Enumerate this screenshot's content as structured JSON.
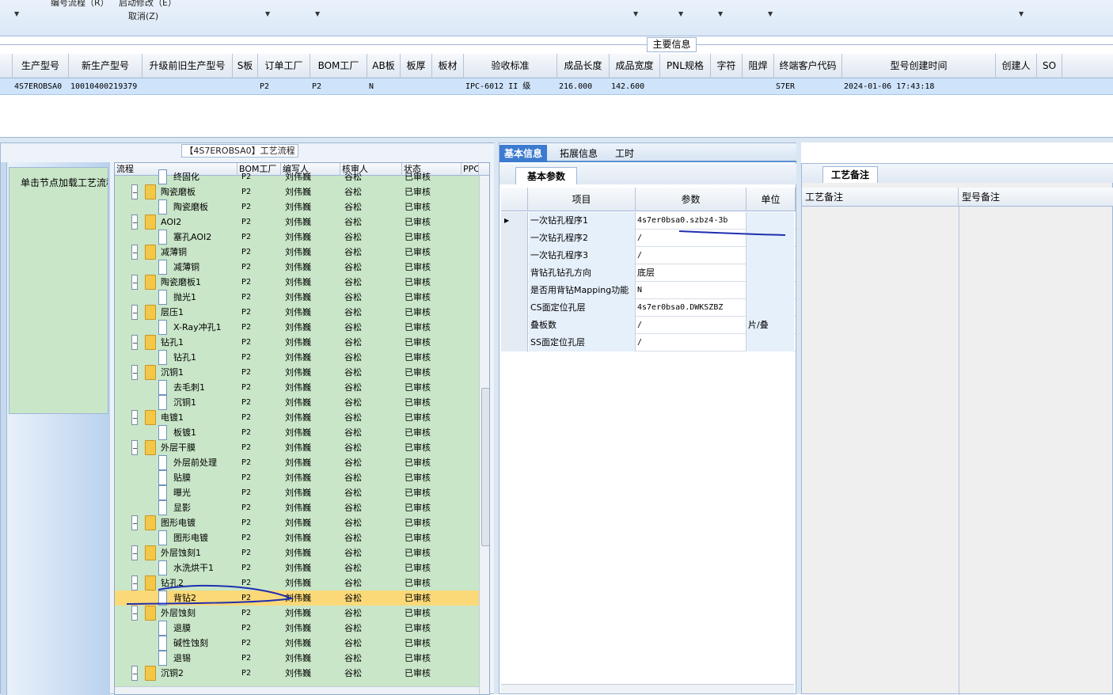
{
  "toolbar": {
    "menu1": "编号流程（R）",
    "menu2": "启动修改（E）",
    "menu3": "取消(Z)"
  },
  "main_info": {
    "title": "主要信息"
  },
  "grid": {
    "columns": [
      "生产型号",
      "新生产型号",
      "升级前旧生产型号",
      "S板",
      "订单工厂",
      "BOM工厂",
      "AB板",
      "板厚",
      "板材",
      "验收标准",
      "成品长度",
      "成品宽度",
      "PNL规格",
      "字符",
      "阻焊",
      "终端客户代码",
      "型号创建时间",
      "创建人",
      "SO"
    ],
    "row": {
      "model": "4S7EROBSA0",
      "new_model": "10010400219379",
      "order_factory": "P2",
      "bom_factory": "P2",
      "ab_board": "N",
      "standard": "IPC-6012 II 级",
      "length": "216.000",
      "width": "142.600",
      "customer_code": "S7ER",
      "created_time": "2024-01-06 17:43:18"
    }
  },
  "flow_panel": {
    "title": "【4S7EROBSA0】工艺流程",
    "load_label": "单击节点加载工艺流程",
    "columns": [
      "流程",
      "BOM工厂",
      "编写人",
      "核审人",
      "状态",
      "PPC"
    ],
    "rows": [
      {
        "level": 2,
        "type": "doc",
        "name": "终固化",
        "factory": "P2",
        "writer": "刘伟巍",
        "reviewer": "谷松",
        "status": "已审核"
      },
      {
        "level": 1,
        "type": "folder",
        "name": "陶瓷磨板",
        "factory": "P2",
        "writer": "刘伟巍",
        "reviewer": "谷松",
        "status": "已审核"
      },
      {
        "level": 2,
        "type": "doc",
        "name": "陶瓷磨板",
        "factory": "P2",
        "writer": "刘伟巍",
        "reviewer": "谷松",
        "status": "已审核"
      },
      {
        "level": 1,
        "type": "folder",
        "name": "AOI2",
        "factory": "P2",
        "writer": "刘伟巍",
        "reviewer": "谷松",
        "status": "已审核"
      },
      {
        "level": 2,
        "type": "doc",
        "name": "塞孔AOI2",
        "factory": "P2",
        "writer": "刘伟巍",
        "reviewer": "谷松",
        "status": "已审核"
      },
      {
        "level": 1,
        "type": "folder",
        "name": "减薄铜",
        "factory": "P2",
        "writer": "刘伟巍",
        "reviewer": "谷松",
        "status": "已审核"
      },
      {
        "level": 2,
        "type": "doc",
        "name": "减薄铜",
        "factory": "P2",
        "writer": "刘伟巍",
        "reviewer": "谷松",
        "status": "已审核"
      },
      {
        "level": 1,
        "type": "folder",
        "name": "陶瓷磨板1",
        "factory": "P2",
        "writer": "刘伟巍",
        "reviewer": "谷松",
        "status": "已审核"
      },
      {
        "level": 2,
        "type": "doc",
        "name": "抛光1",
        "factory": "P2",
        "writer": "刘伟巍",
        "reviewer": "谷松",
        "status": "已审核"
      },
      {
        "level": 1,
        "type": "folder",
        "name": "层压1",
        "factory": "P2",
        "writer": "刘伟巍",
        "reviewer": "谷松",
        "status": "已审核"
      },
      {
        "level": 2,
        "type": "doc",
        "name": "X-Ray冲孔1",
        "factory": "P2",
        "writer": "刘伟巍",
        "reviewer": "谷松",
        "status": "已审核"
      },
      {
        "level": 1,
        "type": "folder",
        "name": "钻孔1",
        "factory": "P2",
        "writer": "刘伟巍",
        "reviewer": "谷松",
        "status": "已审核"
      },
      {
        "level": 2,
        "type": "doc",
        "name": "钻孔1",
        "factory": "P2",
        "writer": "刘伟巍",
        "reviewer": "谷松",
        "status": "已审核"
      },
      {
        "level": 1,
        "type": "folder",
        "name": "沉铜1",
        "factory": "P2",
        "writer": "刘伟巍",
        "reviewer": "谷松",
        "status": "已审核"
      },
      {
        "level": 2,
        "type": "doc",
        "name": "去毛刺1",
        "factory": "P2",
        "writer": "刘伟巍",
        "reviewer": "谷松",
        "status": "已审核"
      },
      {
        "level": 2,
        "type": "doc",
        "name": "沉铜1",
        "factory": "P2",
        "writer": "刘伟巍",
        "reviewer": "谷松",
        "status": "已审核"
      },
      {
        "level": 1,
        "type": "folder",
        "name": "电镀1",
        "factory": "P2",
        "writer": "刘伟巍",
        "reviewer": "谷松",
        "status": "已审核"
      },
      {
        "level": 2,
        "type": "doc",
        "name": "板镀1",
        "factory": "P2",
        "writer": "刘伟巍",
        "reviewer": "谷松",
        "status": "已审核"
      },
      {
        "level": 1,
        "type": "folder",
        "name": "外层干膜",
        "factory": "P2",
        "writer": "刘伟巍",
        "reviewer": "谷松",
        "status": "已审核"
      },
      {
        "level": 2,
        "type": "doc",
        "name": "外层前处理",
        "factory": "P2",
        "writer": "刘伟巍",
        "reviewer": "谷松",
        "status": "已审核"
      },
      {
        "level": 2,
        "type": "doc",
        "name": "贴膜",
        "factory": "P2",
        "writer": "刘伟巍",
        "reviewer": "谷松",
        "status": "已审核"
      },
      {
        "level": 2,
        "type": "doc",
        "name": "曝光",
        "factory": "P2",
        "writer": "刘伟巍",
        "reviewer": "谷松",
        "status": "已审核"
      },
      {
        "level": 2,
        "type": "doc",
        "name": "显影",
        "factory": "P2",
        "writer": "刘伟巍",
        "reviewer": "谷松",
        "status": "已审核"
      },
      {
        "level": 1,
        "type": "folder",
        "name": "图形电镀",
        "factory": "P2",
        "writer": "刘伟巍",
        "reviewer": "谷松",
        "status": "已审核"
      },
      {
        "level": 2,
        "type": "doc",
        "name": "图形电镀",
        "factory": "P2",
        "writer": "刘伟巍",
        "reviewer": "谷松",
        "status": "已审核"
      },
      {
        "level": 1,
        "type": "folder",
        "name": "外层蚀刻1",
        "factory": "P2",
        "writer": "刘伟巍",
        "reviewer": "谷松",
        "status": "已审核"
      },
      {
        "level": 2,
        "type": "doc",
        "name": "水洗烘干1",
        "factory": "P2",
        "writer": "刘伟巍",
        "reviewer": "谷松",
        "status": "已审核"
      },
      {
        "level": 1,
        "type": "folder",
        "name": "钻孔2",
        "factory": "P2",
        "writer": "刘伟巍",
        "reviewer": "谷松",
        "status": "已审核"
      },
      {
        "level": 2,
        "type": "doc",
        "name": "背钻2",
        "factory": "P2",
        "writer": "刘伟巍",
        "reviewer": "谷松",
        "status": "已审核",
        "selected": true
      },
      {
        "level": 1,
        "type": "folder",
        "name": "外层蚀刻",
        "factory": "P2",
        "writer": "刘伟巍",
        "reviewer": "谷松",
        "status": "已审核"
      },
      {
        "level": 2,
        "type": "doc",
        "name": "退膜",
        "factory": "P2",
        "writer": "刘伟巍",
        "reviewer": "谷松",
        "status": "已审核"
      },
      {
        "level": 2,
        "type": "doc",
        "name": "碱性蚀刻",
        "factory": "P2",
        "writer": "刘伟巍",
        "reviewer": "谷松",
        "status": "已审核"
      },
      {
        "level": 2,
        "type": "doc",
        "name": "退锡",
        "factory": "P2",
        "writer": "刘伟巍",
        "reviewer": "谷松",
        "status": "已审核"
      },
      {
        "level": 1,
        "type": "folder",
        "name": "沉铜2",
        "factory": "P2",
        "writer": "刘伟巍",
        "reviewer": "谷松",
        "status": "已审核"
      }
    ]
  },
  "mid_panel": {
    "tabs": [
      "基本信息",
      "拓展信息",
      "工时"
    ],
    "subtab": "基本参数",
    "columns": [
      "项目",
      "参数",
      "单位"
    ],
    "rows": [
      {
        "item": "一次钻孔程序1",
        "param": "4s7er0bsa0.szbz4-3b",
        "unit": ""
      },
      {
        "item": "一次钻孔程序2",
        "param": "/",
        "unit": ""
      },
      {
        "item": "一次钻孔程序3",
        "param": "/",
        "unit": ""
      },
      {
        "item": "背钻孔钻孔方向",
        "param": "底层",
        "unit": ""
      },
      {
        "item": "是否用背钻Mapping功能",
        "param": "N",
        "unit": ""
      },
      {
        "item": "CS面定位孔层",
        "param": "4s7er0bsa0.DWKSZBZ",
        "unit": ""
      },
      {
        "item": "叠板数",
        "param": "/",
        "unit": "片/叠"
      },
      {
        "item": "SS面定位孔层",
        "param": "/",
        "unit": ""
      }
    ]
  },
  "right_panel": {
    "tab": "工艺备注",
    "columns": [
      "工艺备注",
      "型号备注"
    ]
  },
  "colors": {
    "tree_bg": "#c9e6c8",
    "selected_row": "#fbd978",
    "grid_selected": "#cfe3fa",
    "tab_active": "#3d7bd0",
    "pen_ink": "#1f2fb0"
  }
}
